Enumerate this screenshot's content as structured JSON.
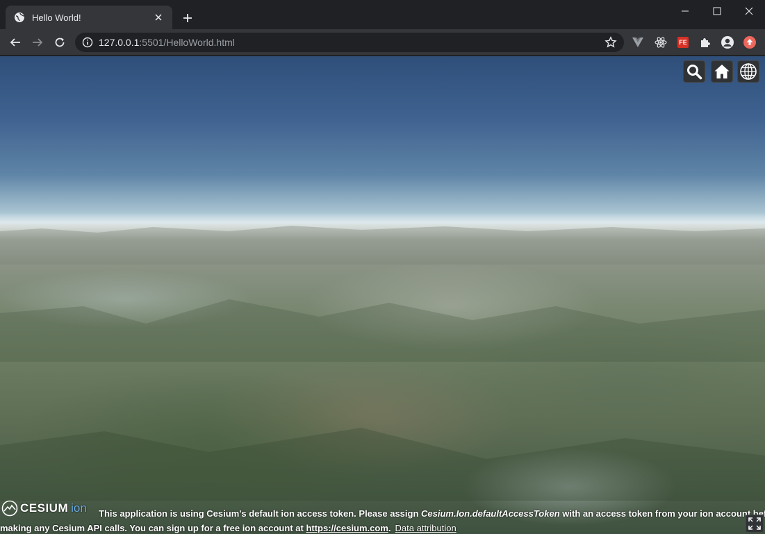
{
  "browser": {
    "tab": {
      "title": "Hello World!",
      "favicon": "globe-icon"
    },
    "window_controls": [
      "minimize-icon",
      "maximize-icon",
      "close-icon"
    ],
    "url": {
      "host": "127.0.0.1",
      "rest": ":5501/HelloWorld.html"
    },
    "extensions": [
      "vue-devtools-icon",
      "react-devtools-icon",
      "fe-helper-icon",
      "puzzle-icon",
      "profile-icon",
      "update-icon"
    ],
    "extension_fe_label": "FE"
  },
  "viewer": {
    "toolbar_buttons": [
      "search-icon",
      "home-icon",
      "globe-icon"
    ],
    "credit": {
      "logo_text": "CESIUM",
      "logo_ion": "ion",
      "line1_a": "This application is using Cesium's default ion access token. Please assign ",
      "line1_em": "Cesium.Ion.defaultAccessToken",
      "line1_b": " with an access token from your ion account before",
      "line2_a": "making any Cesium API calls. You can sign up for a free ion account at ",
      "line2_link": "https://cesium.com",
      "line2_dot": ".",
      "data_attribution": "Data attribution"
    },
    "colors": {
      "sky_top": "#2f4f7a",
      "horizon": "#d6e4e9",
      "terrain": "#6c7d63",
      "ion_blue": "#6cade5"
    }
  }
}
